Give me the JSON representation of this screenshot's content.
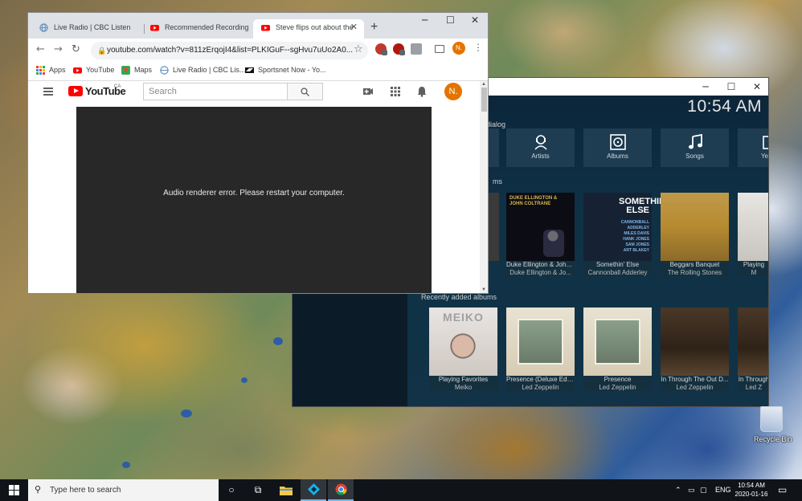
{
  "chrome": {
    "tabs": [
      {
        "title": "Live Radio | CBC Listen",
        "active": false
      },
      {
        "title": "Recommended Recording",
        "active": false
      },
      {
        "title": "Steve flips out about the",
        "active": true
      }
    ],
    "url": "youtube.com/watch?v=811zErqojI4&list=PLKIGuF--sgHvu7uUo2A0...",
    "bookmarks": [
      "Apps",
      "YouTube",
      "Maps",
      "Live Radio | CBC Lis...",
      "Sportsnet Now - Yo..."
    ],
    "profile_initial": "N."
  },
  "youtube": {
    "logo_text": "YouTube",
    "region": "CA",
    "search_placeholder": "Search",
    "avatar_initial": "N.",
    "error_message": "Audio renderer error. Please restart your computer."
  },
  "kodi": {
    "clock": "10:54 AM",
    "section_top": "dialog",
    "section_mid": "ms",
    "section_recent": "Recently added albums",
    "tiles": [
      "Artists",
      "Albums",
      "Songs",
      "Ye"
    ],
    "albums_row1": [
      {
        "title": "Duke Ellington & John ...",
        "artist": "Duke Ellington & Jo..."
      },
      {
        "title": "Somethin' Else",
        "artist": "Cannonball Adderley"
      },
      {
        "title": "Beggars Banquet",
        "artist": "The Rolling Stones"
      },
      {
        "title": "Playing",
        "artist": "M"
      }
    ],
    "albums_row2": [
      {
        "title": "Playing Favorites",
        "artist": "Meiko"
      },
      {
        "title": "Presence (Deluxe Edit...",
        "artist": "Led Zeppelin"
      },
      {
        "title": "Presence",
        "artist": "Led Zeppelin"
      },
      {
        "title": "In Through The Out D...",
        "artist": "Led Zeppelin"
      },
      {
        "title": "In Through",
        "artist": "Led Z"
      }
    ],
    "cover_text": {
      "duke": "DUKE ELLINGTON & JOHN COLTRANE",
      "somethin": "SOMETHIN' ELSE",
      "somethin_names": "CANNONBALL ADDERLEY MILES DAVIS HANK JONES SAM JONES ART BLAKEY",
      "meiko": "MEIKO"
    }
  },
  "desktop": {
    "recycle_label": "Recycle Bin"
  },
  "taskbar": {
    "search_placeholder": "Type here to search",
    "language": "ENG",
    "time": "10:54 AM",
    "date": "2020-01-16"
  }
}
